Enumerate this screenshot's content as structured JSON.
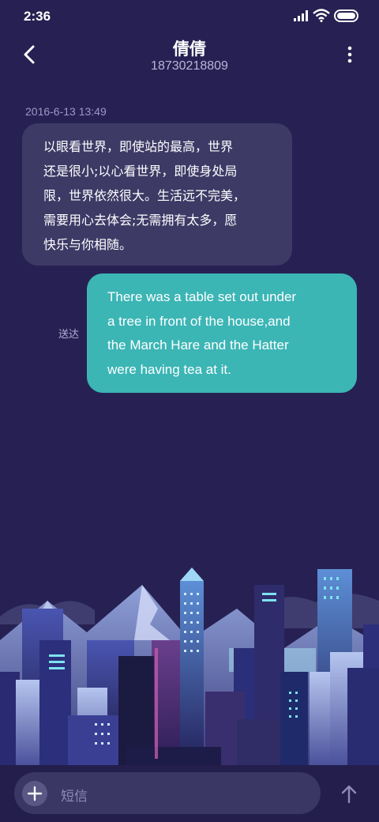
{
  "status_bar": {
    "time": "2:36",
    "icons": [
      "signal-icon",
      "wifi-icon",
      "battery-icon"
    ]
  },
  "header": {
    "contact_name": "倩倩",
    "contact_number": "18730218809",
    "back_icon": "chevron-left-icon",
    "more_icon": "more-vertical-icon"
  },
  "messages": [
    {
      "direction": "received",
      "timestamp": "2016-6-13 13:49",
      "text": "以眼看世界，即使站的最高，世界\n还是很小;以心看世界，即使身处局\n限，世界依然很大。生活远不完美，\n需要用心去体会;无需拥有太多，愿\n快乐与你相随。"
    },
    {
      "direction": "sent",
      "status": "送达",
      "text": "There was a table set out under\na tree in front of the house,and\nthe March Hare and the Hatter\nwere having tea at it."
    }
  ],
  "composer": {
    "placeholder": "短信",
    "add_icon": "plus-icon",
    "send_icon": "arrow-up-icon"
  },
  "colors": {
    "background": "#262152",
    "received_bubble": "#3d3a66",
    "sent_bubble": "#3cb5b5",
    "input_field": "#3a3765"
  }
}
